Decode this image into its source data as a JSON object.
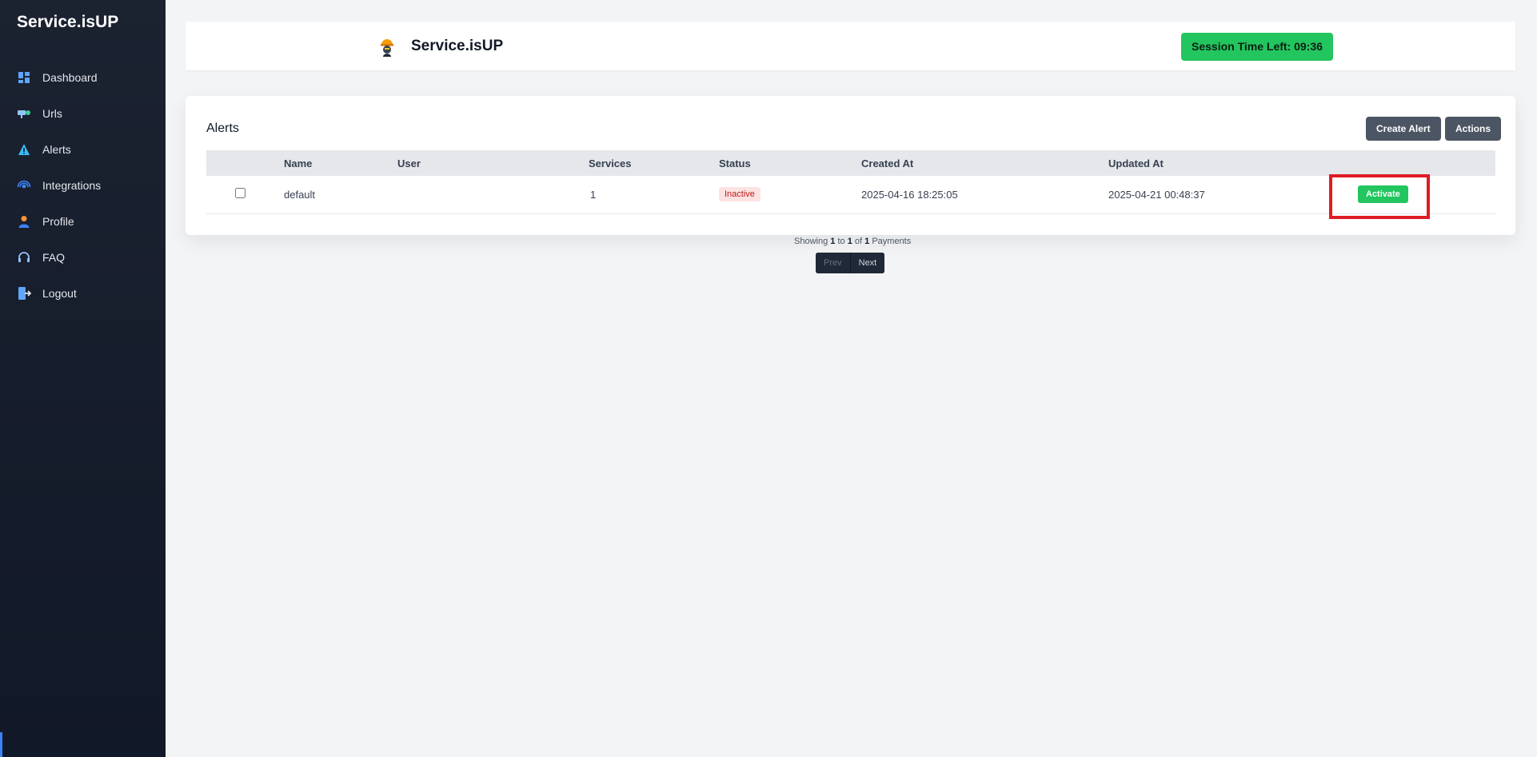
{
  "sidebar": {
    "brand": "Service.isUP",
    "items": [
      {
        "label": "Dashboard",
        "icon": "dashboard-icon"
      },
      {
        "label": "Urls",
        "icon": "urls-icon"
      },
      {
        "label": "Alerts",
        "icon": "alert-icon"
      },
      {
        "label": "Integrations",
        "icon": "integrations-icon"
      },
      {
        "label": "Profile",
        "icon": "profile-icon"
      },
      {
        "label": "FAQ",
        "icon": "headset-icon"
      },
      {
        "label": "Logout",
        "icon": "logout-icon"
      }
    ]
  },
  "header": {
    "title": "Service.isUP",
    "session": "Session Time Left: 09:36"
  },
  "alerts": {
    "title": "Alerts",
    "create_label": "Create Alert",
    "actions_label": "Actions",
    "columns": [
      "Name",
      "User",
      "Services",
      "Status",
      "Created At",
      "Updated At"
    ],
    "rows": [
      {
        "name": "default",
        "user": "",
        "services": "1",
        "status": "Inactive",
        "created_at": "2025-04-16 18:25:05",
        "updated_at": "2025-04-21 00:48:37",
        "action": "Activate"
      }
    ]
  },
  "pagination": {
    "prefix": "Showing",
    "from": "1",
    "to_word": "to",
    "to": "1",
    "of_word": "of",
    "total": "1",
    "suffix": "Payments",
    "prev_label": "Prev",
    "next_label": "Next"
  },
  "colors": {
    "sidebar": "#111827",
    "success": "#22c55e",
    "danger_badge": "#fde2e2",
    "highlight": "#e01b24"
  }
}
